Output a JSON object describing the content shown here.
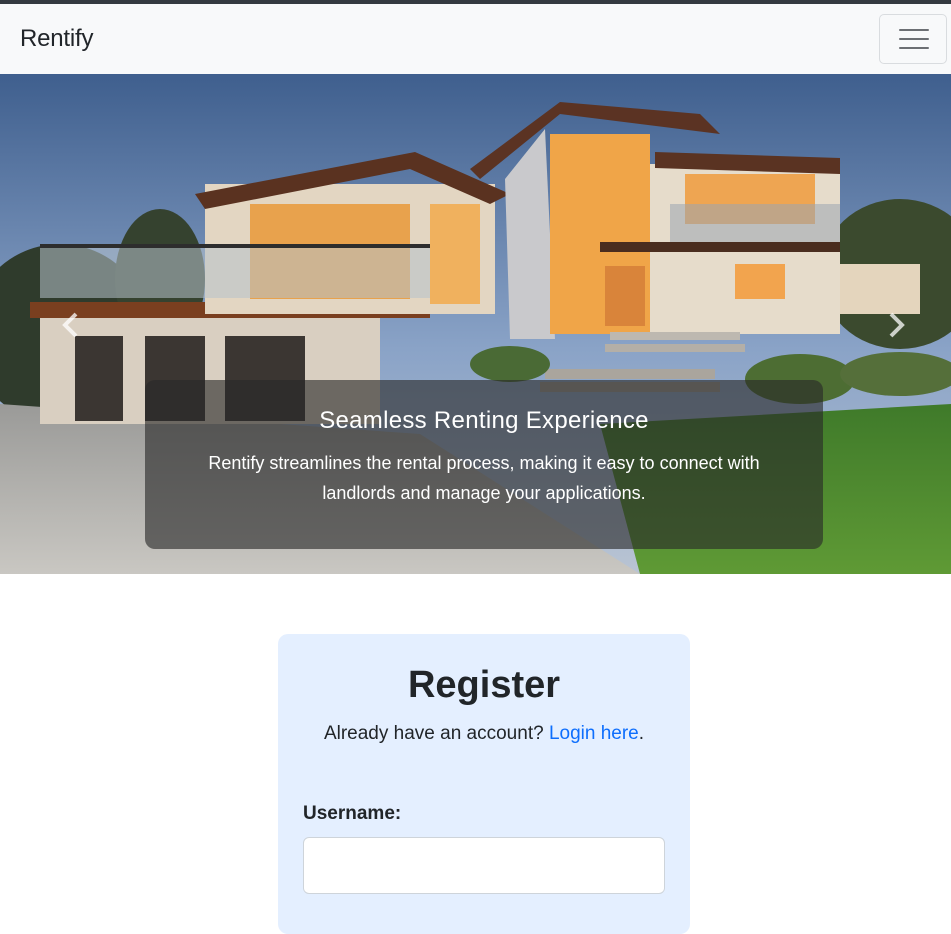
{
  "navbar": {
    "brand": "Rentify",
    "toggler_icon": "hamburger-menu-icon"
  },
  "carousel": {
    "prev_icon": "chevron-left-icon",
    "next_icon": "chevron-right-icon",
    "slide": {
      "title": "Seamless Renting Experience",
      "text": "Rentify streamlines the rental process, making it easy to connect with landlords and manage your applications."
    }
  },
  "register": {
    "title": "Register",
    "prompt": "Already have an account?",
    "login_link": "Login here",
    "period": ".",
    "username_label": "Username:",
    "username_value": ""
  },
  "colors": {
    "navbar_bg": "#f8f9fa",
    "card_bg": "#e4efff",
    "link": "#0d6efd"
  }
}
